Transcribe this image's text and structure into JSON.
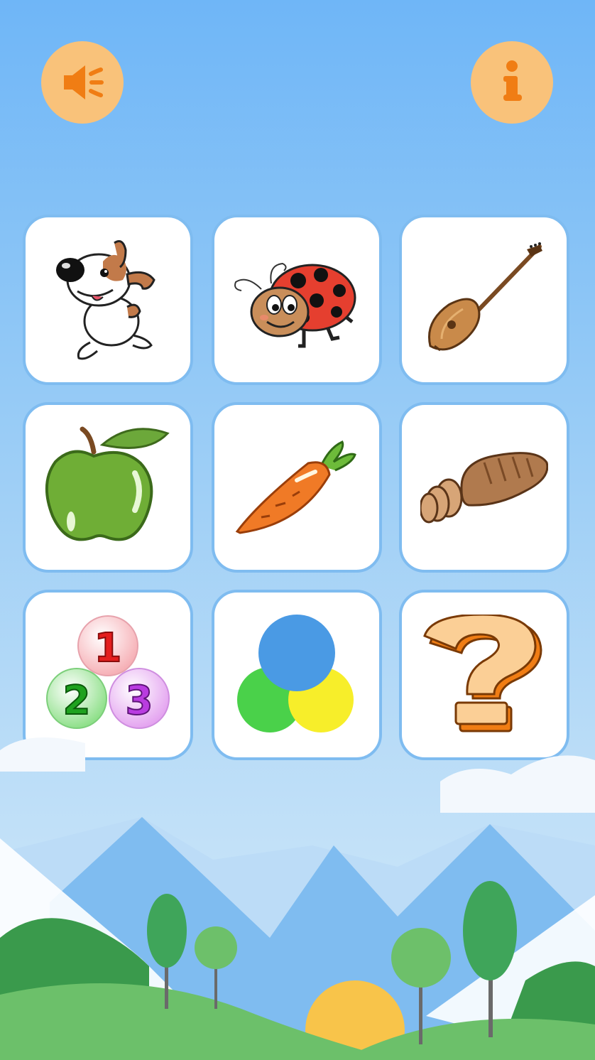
{
  "app": {
    "title": "",
    "colors": {
      "sky_top": "#6fb6f7",
      "sky_bottom": "#d5ebfb",
      "button_bg": "#f9c27a",
      "button_icon": "#f07d14",
      "card_border": "#7fbcf0"
    }
  },
  "header": {
    "sound_button": {
      "icon": "speaker-icon"
    },
    "info_button": {
      "icon": "info-icon"
    }
  },
  "categories": [
    {
      "id": "animals",
      "icon": "dog-icon"
    },
    {
      "id": "insects",
      "icon": "ladybug-icon"
    },
    {
      "id": "instruments",
      "icon": "dombra-icon"
    },
    {
      "id": "fruits",
      "icon": "apple-icon"
    },
    {
      "id": "vegetables",
      "icon": "carrot-icon"
    },
    {
      "id": "food",
      "icon": "bread-icon"
    },
    {
      "id": "numbers",
      "icon": "numbers-icon",
      "labels": [
        "1",
        "2",
        "3"
      ]
    },
    {
      "id": "colors",
      "icon": "colors-icon"
    },
    {
      "id": "quiz",
      "icon": "question-mark-icon"
    }
  ],
  "background": {
    "icon": "landscape-illustration"
  }
}
